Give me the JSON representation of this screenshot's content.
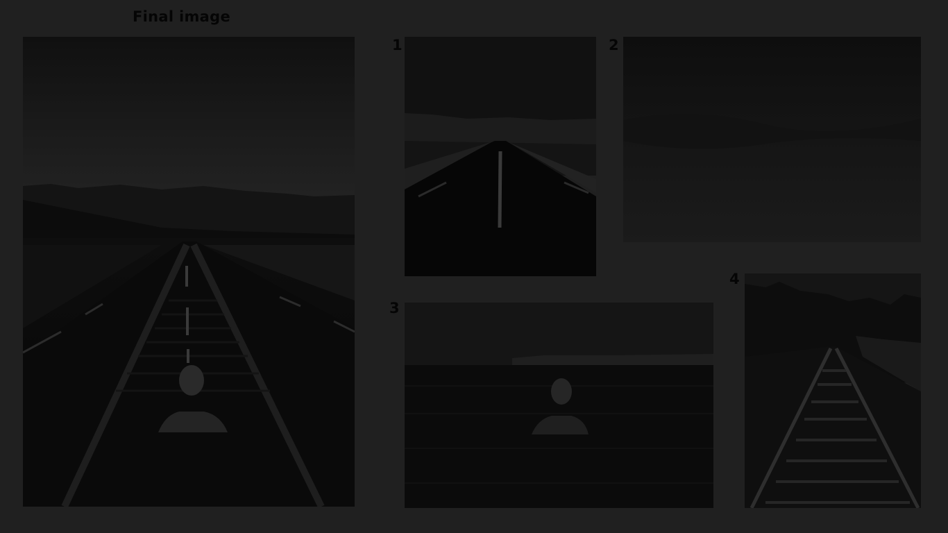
{
  "title": "Final image",
  "steps": [
    {
      "number": "1"
    },
    {
      "number": "2"
    },
    {
      "number": "3"
    },
    {
      "number": "4"
    }
  ]
}
